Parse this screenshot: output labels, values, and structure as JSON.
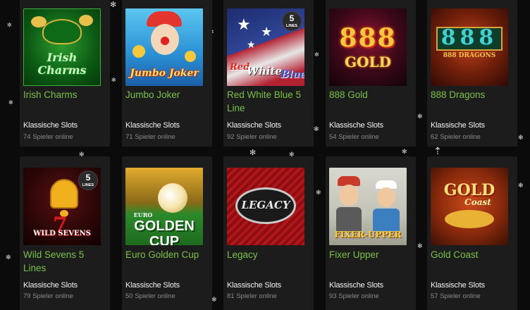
{
  "category_label": "Klassische Slots",
  "games_row1": [
    {
      "title": "Irish Charms",
      "category": "Klassische Slots",
      "players": "74 Spieler online",
      "art": "Irish Charms"
    },
    {
      "title": "Jumbo Joker",
      "category": "Klassische Slots",
      "players": "71 Spieler online",
      "art": "Jumbo Joker"
    },
    {
      "title": "Red White Blue 5 Line",
      "category": "Klassische Slots",
      "players": "92 Spieler online",
      "art_red": "Red",
      "art_white": "White",
      "art_blue": "Blue",
      "badge_num": "5",
      "badge_text": "LINES"
    },
    {
      "title": "888 Gold",
      "category": "Klassische Slots",
      "players": "54 Spieler online",
      "art_top": "888",
      "art_bottom": "GOLD"
    },
    {
      "title": "888 Dragons",
      "category": "Klassische Slots",
      "players": "62 Spieler online",
      "art_top": "888",
      "art_bottom": "888 DRAGONS"
    }
  ],
  "games_row2": [
    {
      "title": "Wild Sevens 5 Lines",
      "category": "Klassische Slots",
      "players": "79 Spieler online",
      "art": "WILD SEVENS",
      "badge_num": "5",
      "badge_text": "LINES"
    },
    {
      "title": "Euro Golden Cup",
      "category": "Klassische Slots",
      "players": "50 Spieler online",
      "art_small": "EURO",
      "art": "GOLDEN CUP"
    },
    {
      "title": "Legacy",
      "category": "Klassische Slots",
      "players": "81 Spieler online",
      "art": "LEGACY"
    },
    {
      "title": "Fixer Upper",
      "category": "Klassische Slots",
      "players": "93 Spieler online",
      "art": "FIXER-UPPER"
    },
    {
      "title": "Gold Coast",
      "category": "Klassische Slots",
      "players": "57 Spieler online",
      "art_top": "GOLD",
      "art_bottom": "Coast"
    }
  ],
  "icons": {
    "snowflake": "snowflake-icon",
    "scroll_up": "arrow-up-icon"
  }
}
